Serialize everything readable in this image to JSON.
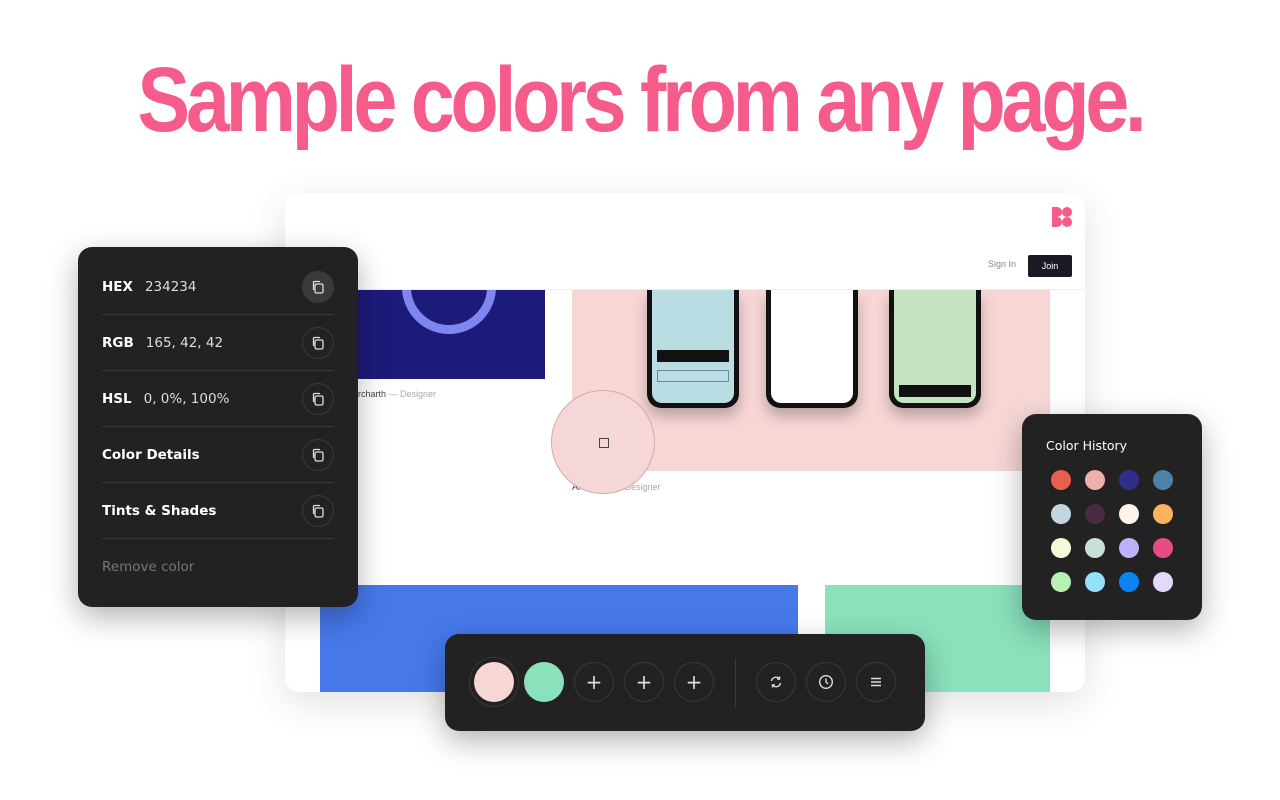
{
  "headline": "Sample colors from any page.",
  "site": {
    "sign_in": "Sign In",
    "join": "Join",
    "caption1_name": "rcharth",
    "caption1_role": " — Designer",
    "caption2_name": "Ar        ez",
    "caption2_role": " — Designer",
    "brand_color": "#f55c8c"
  },
  "color_panel": {
    "rows": [
      {
        "label": "HEX",
        "value": "234234"
      },
      {
        "label": "RGB",
        "value": "165, 42, 42"
      },
      {
        "label": "HSL",
        "value": "0, 0%, 100%"
      },
      {
        "label": "Color Details",
        "value": ""
      },
      {
        "label": "Tints & Shades",
        "value": ""
      }
    ],
    "remove": "Remove color"
  },
  "history": {
    "title": "Color History",
    "colors": [
      "#e8604b",
      "#efb0aa",
      "#2f2e8a",
      "#4e81a3",
      "#c2d6e2",
      "#4a2a40",
      "#fdf5ec",
      "#fcb35e",
      "#f4fbd8",
      "#c9e0da",
      "#bdb1f7",
      "#e54c87",
      "#b5f2b3",
      "#95e1fb",
      "#0a84f4",
      "#e3d9f9"
    ]
  },
  "toolbar": {
    "swatches": [
      "#f7d6d6",
      "#8ae2bc"
    ],
    "add_icon": "+",
    "actions": [
      "refresh-icon",
      "clock-icon",
      "menu-icon"
    ]
  }
}
